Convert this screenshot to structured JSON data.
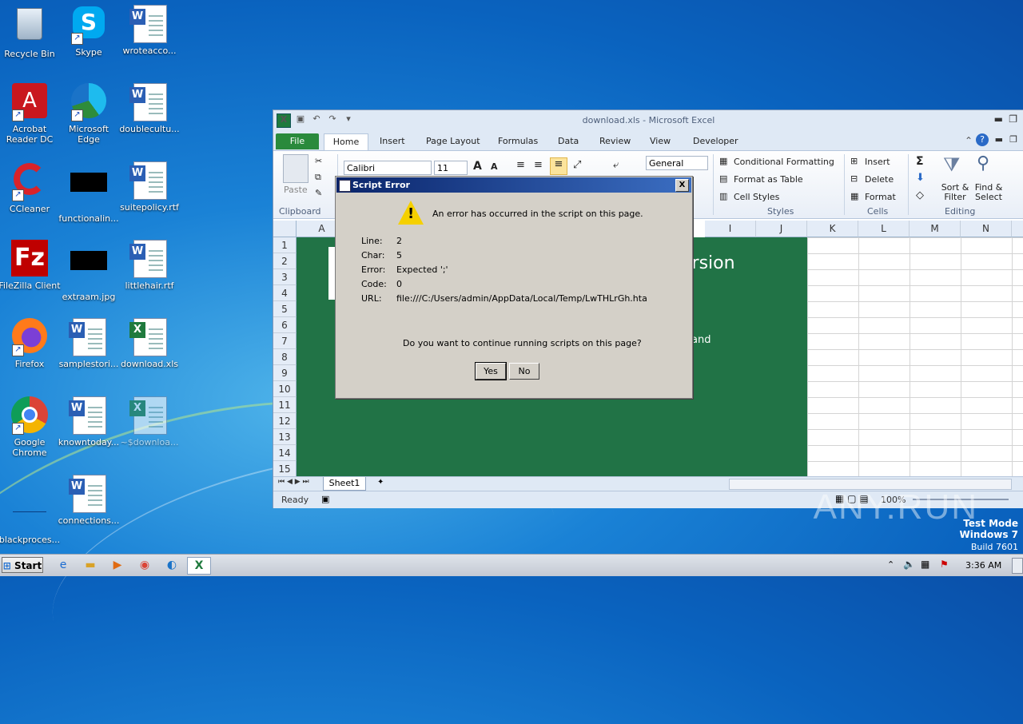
{
  "desktop": {
    "icons": [
      {
        "label": "Recycle Bin"
      },
      {
        "label": "Skype"
      },
      {
        "label": "wroteacco..."
      },
      {
        "label": "Acrobat Reader DC"
      },
      {
        "label": "Microsoft Edge"
      },
      {
        "label": "doublecultu..."
      },
      {
        "label": "CCleaner"
      },
      {
        "label": "functionalin..."
      },
      {
        "label": "suitepolicy.rtf"
      },
      {
        "label": "FileZilla Client"
      },
      {
        "label": "extraam.jpg"
      },
      {
        "label": "littlehair.rtf"
      },
      {
        "label": "Firefox"
      },
      {
        "label": "samplestori..."
      },
      {
        "label": "download.xls"
      },
      {
        "label": "Google Chrome"
      },
      {
        "label": "knowntoday..."
      },
      {
        "label": "~$downloa..."
      },
      {
        "label": "blackproces..."
      },
      {
        "label": "connections..."
      }
    ]
  },
  "excel": {
    "title": "download.xls  -  Microsoft Excel",
    "tabs": [
      "File",
      "Home",
      "Insert",
      "Page Layout",
      "Formulas",
      "Data",
      "Review",
      "View",
      "Developer"
    ],
    "ribbon": {
      "paste": "Paste",
      "clipboard": "Clipboard",
      "font_name": "Calibri",
      "font_size": "11",
      "number_format": "General",
      "conditional_formatting": "Conditional Formatting",
      "format_as_table": "Format as Table",
      "cell_styles": "Cell Styles",
      "styles": "Styles",
      "insert": "Insert",
      "delete": "Delete",
      "format": "Format",
      "cells": "Cells",
      "sort_filter": "Sort & Filter",
      "find_select": "Find & Select",
      "editing": "Editing"
    },
    "columns": [
      "A",
      "I",
      "J",
      "K",
      "L",
      "M",
      "N"
    ],
    "rows": [
      "1",
      "2",
      "3",
      "4",
      "5",
      "6",
      "7",
      "8",
      "9",
      "10",
      "11",
      "12",
      "13",
      "14",
      "15"
    ],
    "sheet_text_1": "version",
    "sheet_text_2": "and",
    "sheet_tab": "Sheet1",
    "status": "Ready",
    "zoom": "100%"
  },
  "dialog": {
    "title": "Script Error",
    "message": "An error has occurred in the script on this page.",
    "fields": [
      {
        "label": "Line:",
        "value": "2"
      },
      {
        "label": "Char:",
        "value": "5"
      },
      {
        "label": "Error:",
        "value": "Expected ';'"
      },
      {
        "label": "Code:",
        "value": "0"
      },
      {
        "label": "URL:",
        "value": "file:///C:/Users/admin/AppData/Local/Temp/LwTHLrGh.hta"
      }
    ],
    "question": "Do you want to continue running scripts on this page?",
    "yes": "Yes",
    "no": "No",
    "close": "X"
  },
  "taskbar": {
    "start": "Start",
    "clock": "3:36 AM"
  },
  "watermark": {
    "brand": "ANY.RUN",
    "line1": "Test Mode",
    "line2": "Windows 7",
    "line3": "Build 7601"
  }
}
